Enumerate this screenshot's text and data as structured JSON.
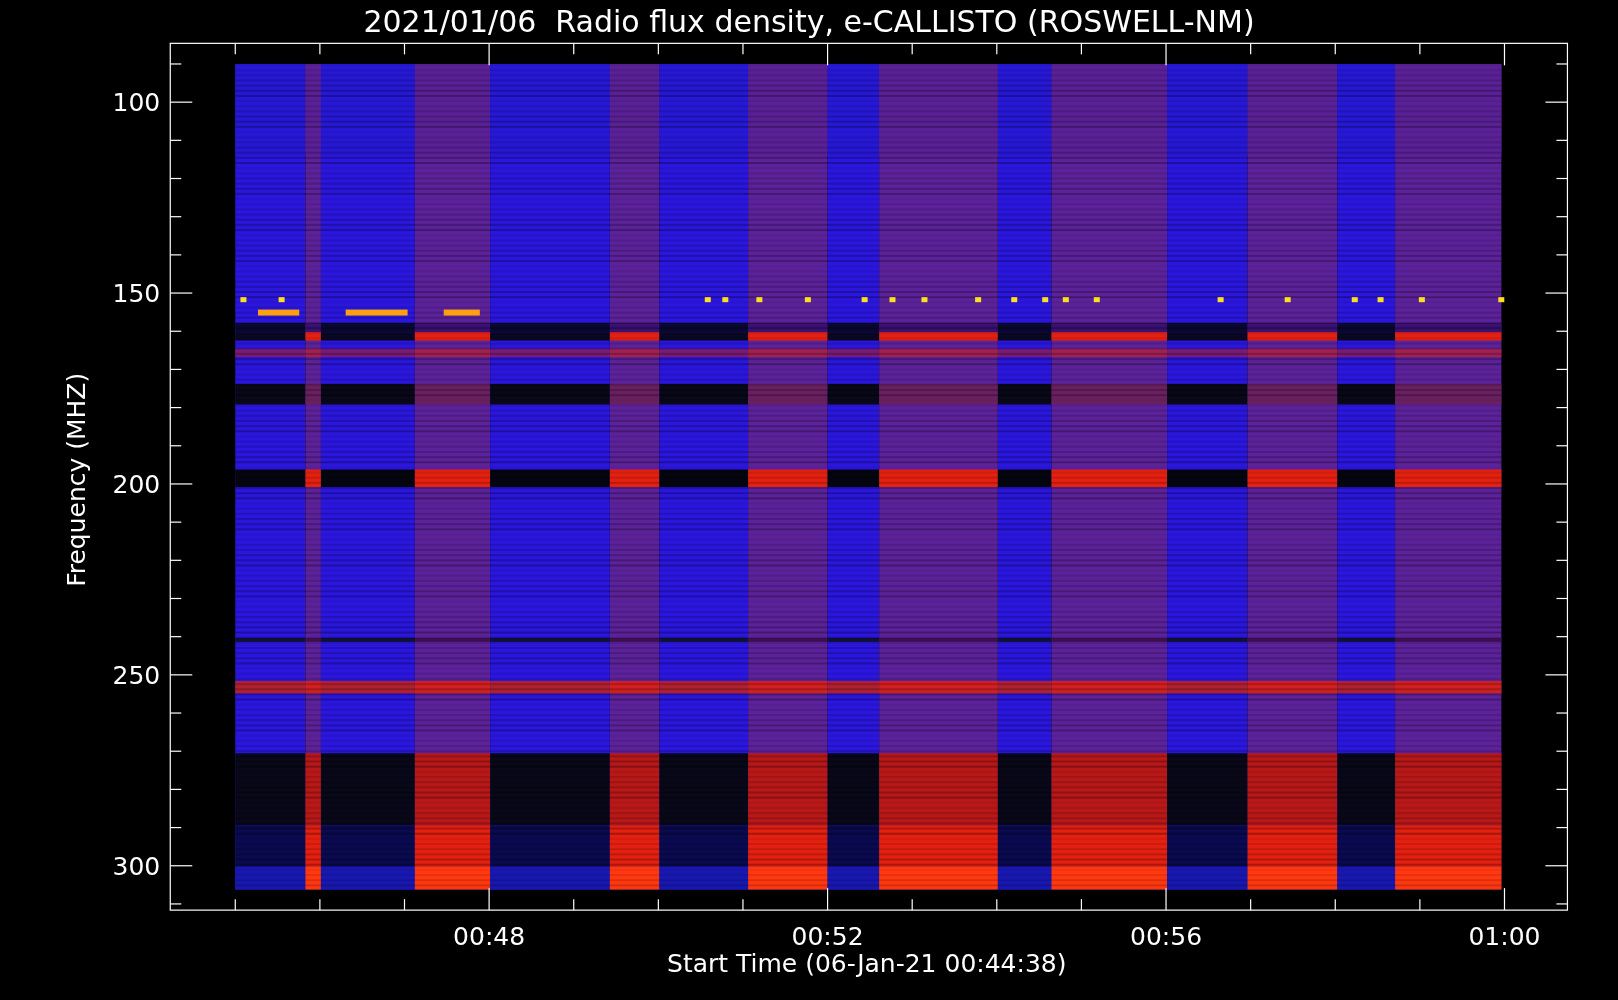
{
  "title": "2021/01/06  Radio flux density, e-CALLISTO (ROSWELL-NM)",
  "plot": {
    "ylabel": "Frequency (MHZ)",
    "xlabel": "Start Time (06-Jan-21 00:44:38)",
    "yticks": [
      "100",
      "150",
      "200",
      "250",
      "300"
    ],
    "xticks": [
      "00:48",
      "00:52",
      "00:56",
      "01:00"
    ]
  }
}
